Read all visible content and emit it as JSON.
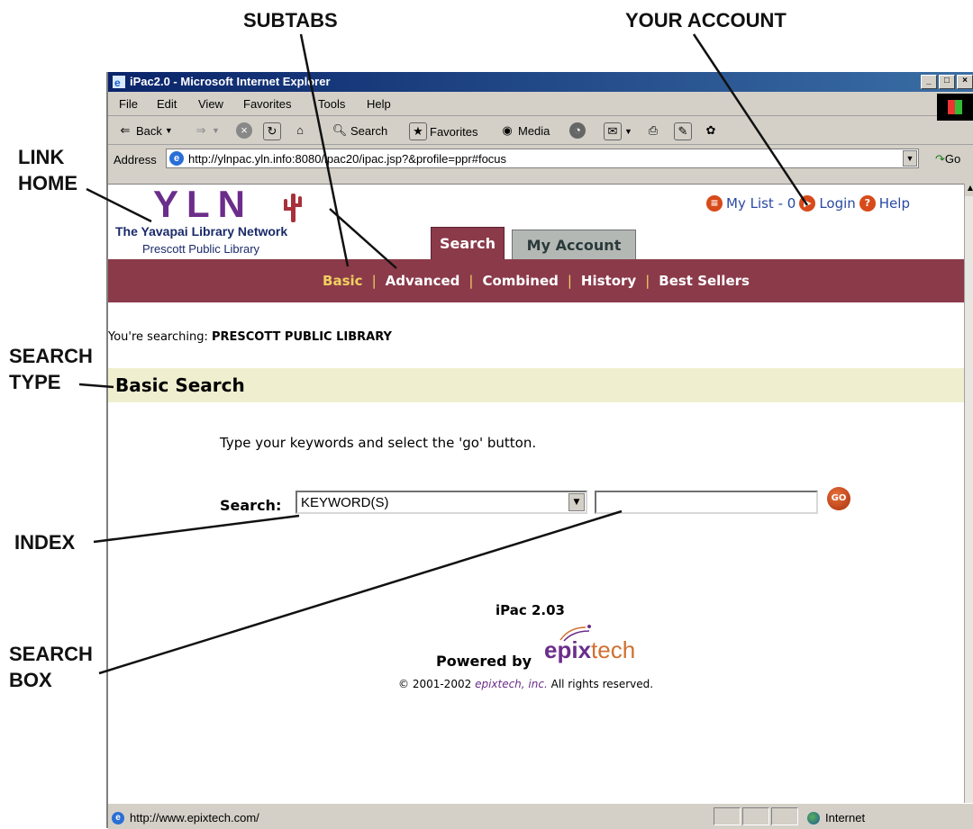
{
  "annotations": {
    "subtabs": "SUBTABS",
    "your_account": "YOUR ACCOUNT",
    "link_home_1": "LINK",
    "link_home_2": "HOME",
    "search_type_1": "SEARCH",
    "search_type_2": "TYPE",
    "index": "INDEX",
    "search_box_1": "SEARCH",
    "search_box_2": "BOX"
  },
  "window": {
    "title": "iPac2.0 - Microsoft Internet Explorer",
    "menu": [
      "File",
      "Edit",
      "View",
      "Favorites",
      "Tools",
      "Help"
    ],
    "toolbar": {
      "back": "Back",
      "search": "Search",
      "favorites": "Favorites",
      "media": "Media"
    },
    "address_label": "Address",
    "address_url": "http://ylnpac.yln.info:8080/ipac20/ipac.jsp?&profile=ppr#focus",
    "go_label": "Go"
  },
  "page": {
    "logo_text": "YLN",
    "network_name": "The Yavapai Library Network",
    "library_name": "Prescott Public Library",
    "top_links": {
      "my_list": "My List - 0",
      "login": "Login",
      "help": "Help"
    },
    "tabs": {
      "search": "Search",
      "my_account": "My Account"
    },
    "subtabs": [
      "Basic",
      "Advanced",
      "Combined",
      "History",
      "Best Sellers"
    ],
    "active_subtab": "Basic",
    "searching_prefix": "You're searching:",
    "searching_library": "PRESCOTT PUBLIC LIBRARY",
    "search_type_title": "Basic Search",
    "instructions": "Type your keywords and select the 'go' button.",
    "search_label": "Search:",
    "index_value": "KEYWORD(S)",
    "search_box_value": "",
    "go_button": "GO",
    "version": "iPac 2.03",
    "powered_by": "Powered by",
    "brand_epix": "epix",
    "brand_tech": "tech",
    "copyright_prefix": "© 2001-2002",
    "copyright_company": "epixtech, inc.",
    "copyright_suffix": "All rights reserved."
  },
  "status": {
    "url": "http://www.epixtech.com/",
    "zone": "Internet"
  },
  "colors": {
    "nav_maroon": "#8b3a4a",
    "active_subtab": "#f0d060",
    "search_type_band": "#efefd0",
    "logo_purple": "#6b2d8a",
    "titlebar_blue": "#0a246a"
  }
}
